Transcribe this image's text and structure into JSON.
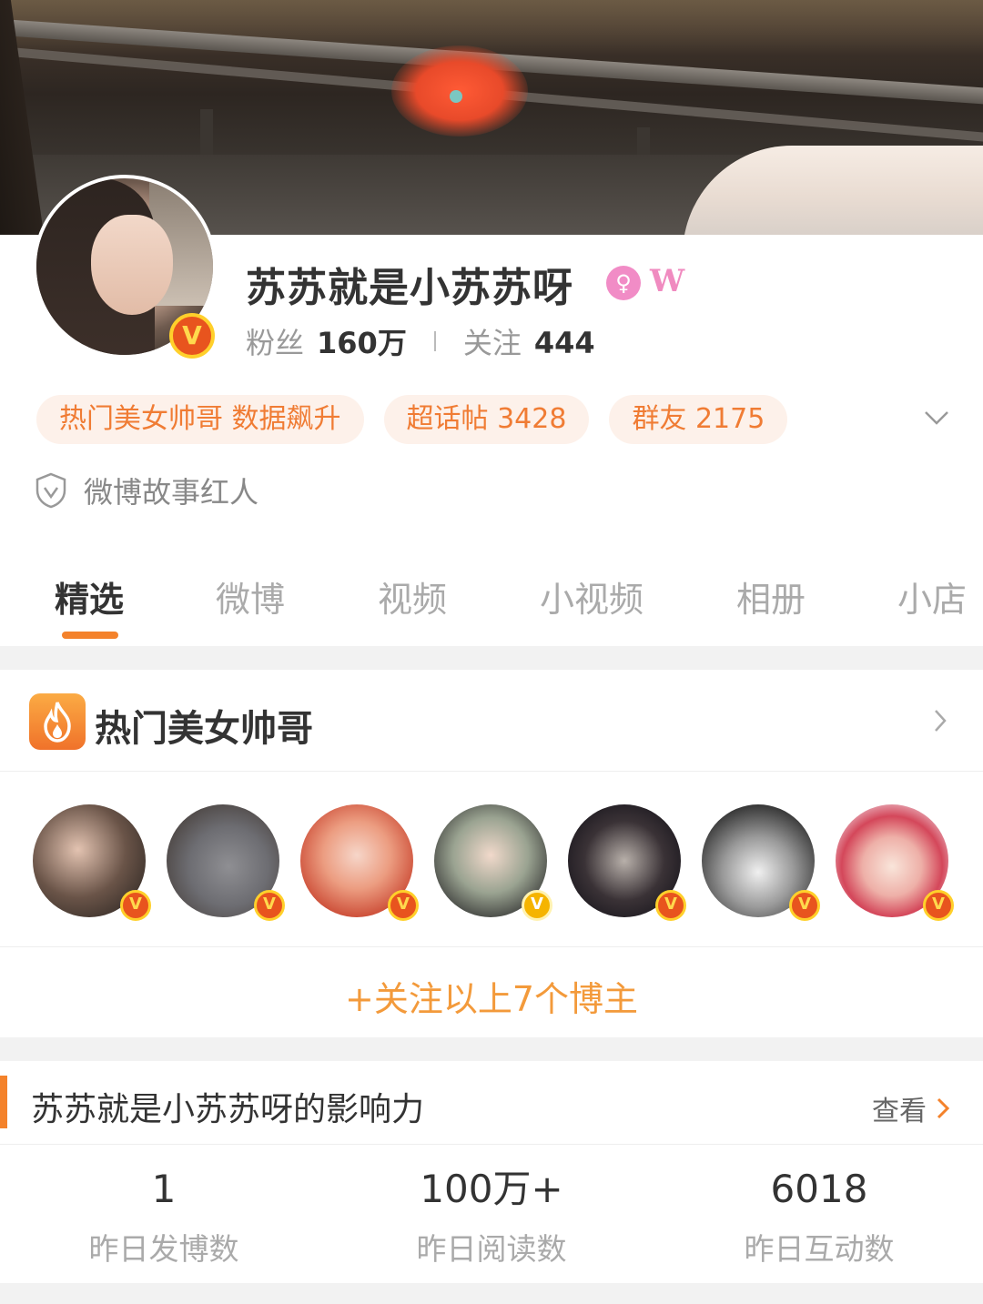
{
  "profile": {
    "name": "苏苏就是小苏苏呀",
    "verified_badge": "V",
    "gender_icon": "female-icon",
    "w_badge": "W",
    "fans_label": "粉丝",
    "fans_count": "160万",
    "following_label": "关注",
    "following_count": "444",
    "tags": [
      "热门美女帅哥 数据飙升",
      "超话帖 3428",
      "群友 2175"
    ],
    "story_label": "微博故事红人"
  },
  "tabs": [
    "精选",
    "微博",
    "视频",
    "小视频",
    "相册",
    "小店"
  ],
  "active_tab": "精选",
  "hot": {
    "title": "热门美女帅哥",
    "follow_all": "+关注以上7个博主",
    "badges": [
      "V",
      "V",
      "V",
      "V",
      "V",
      "V",
      "V"
    ]
  },
  "influence": {
    "title": "苏苏就是小苏苏呀的影响力",
    "link": "查看",
    "metrics": [
      {
        "value": "1",
        "label": "昨日发博数"
      },
      {
        "value": "100万+",
        "label": "昨日阅读数"
      },
      {
        "value": "6018",
        "label": "昨日互动数"
      }
    ]
  },
  "colors": {
    "accent": "#f4822b",
    "tag_text": "#f07c34",
    "tag_bg": "#fdf1ea",
    "follow_text": "#f39a3b",
    "verified_orange": "#e8541e",
    "verified_gold": "#f5b400",
    "gender_pink": "#f18cc6"
  }
}
